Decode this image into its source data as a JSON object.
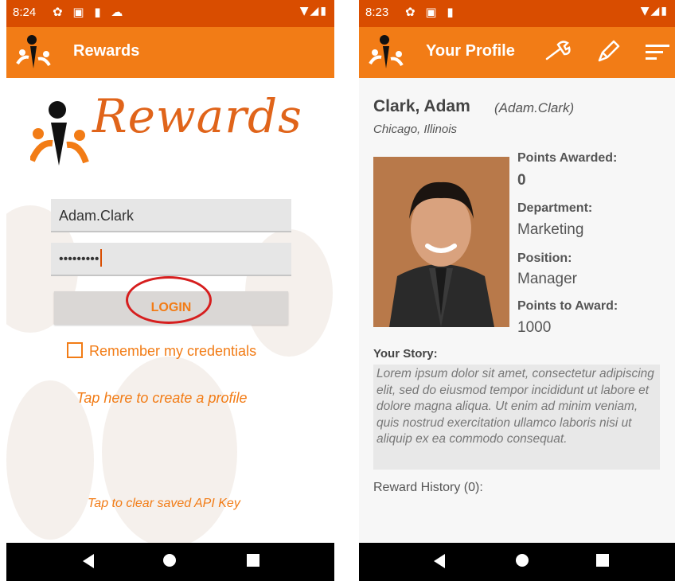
{
  "left": {
    "status": {
      "time": "8:24"
    },
    "app_title": "Rewards",
    "brand_text": "Rewards",
    "username_value": "Adam.Clark",
    "password_value": "•••••••••",
    "login_label": "LOGIN",
    "remember_label": "Remember my credentials",
    "create_profile_link": "Tap here to create a profile",
    "clear_key_link": "Tap to clear saved API Key"
  },
  "right": {
    "status": {
      "time": "8:23"
    },
    "app_title": "Your Profile",
    "name": "Clark, Adam",
    "username": "(Adam.Clark)",
    "location": "Chicago, Illinois",
    "points_awarded_label": "Points Awarded:",
    "points_awarded": "0",
    "department_label": "Department:",
    "department": "Marketing",
    "position_label": "Position:",
    "position": "Manager",
    "points_to_award_label": "Points to Award:",
    "points_to_award": "1000",
    "story_label": "Your Story:",
    "story": "Lorem ipsum dolor sit amet, consectetur adipiscing elit, sed do eiusmod tempor incididunt ut labore et dolore magna aliqua. Ut enim ad minim veniam, quis nostrud exercitation ullamco laboris nisi ut aliquip ex ea commodo consequat.",
    "reward_history": "Reward History (0):"
  },
  "colors": {
    "status_bar": "#d94d00",
    "app_bar": "#f27c16",
    "accent_text": "#f27c16",
    "annotation_circle": "#d61e1e"
  },
  "icons": [
    "settings-icon",
    "image-icon",
    "sd-card-icon",
    "cloud-icon",
    "wifi-icon",
    "signal-icon",
    "battery-icon",
    "app-logo-icon",
    "wrench-icon",
    "pencil-icon",
    "sort-icon",
    "nav-back-icon",
    "nav-home-icon",
    "nav-recents-icon"
  ]
}
